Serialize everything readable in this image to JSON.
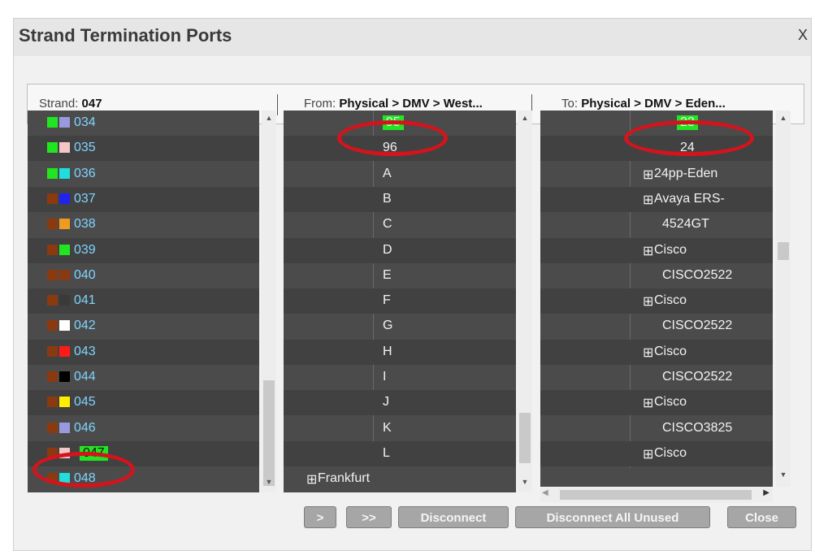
{
  "dialog": {
    "title": "Strand Termination Ports",
    "close_label": "X"
  },
  "header": {
    "strand_label": "Strand:",
    "strand_value": "047",
    "from_label": "From:",
    "from_value": "Physical > DMV > West...",
    "to_label": "To:",
    "to_value": "Physical > DMV > Eden..."
  },
  "strands": [
    {
      "id": "034",
      "c1": "#22e522",
      "c2": "#9999dd"
    },
    {
      "id": "035",
      "c1": "#22e522",
      "c2": "#f4c6c6"
    },
    {
      "id": "036",
      "c1": "#22e522",
      "c2": "#22dddd"
    },
    {
      "id": "037",
      "c1": "#8b3a10",
      "c2": "#2222ee"
    },
    {
      "id": "038",
      "c1": "#8b3a10",
      "c2": "#f09a20"
    },
    {
      "id": "039",
      "c1": "#8b3a10",
      "c2": "#22e522"
    },
    {
      "id": "040",
      "c1": "#8b3a10",
      "c2": "#8b3a10"
    },
    {
      "id": "041",
      "c1": "#8b3a10",
      "c2": "#3a3a3a"
    },
    {
      "id": "042",
      "c1": "#8b3a10",
      "c2": "#ffffff"
    },
    {
      "id": "043",
      "c1": "#8b3a10",
      "c2": "#ff1a1a"
    },
    {
      "id": "044",
      "c1": "#8b3a10",
      "c2": "#000000"
    },
    {
      "id": "045",
      "c1": "#8b3a10",
      "c2": "#ffee00"
    },
    {
      "id": "046",
      "c1": "#8b3a10",
      "c2": "#9999dd"
    },
    {
      "id": "047",
      "c1": "#8b3a10",
      "c2": "#f4c6c6",
      "selected": true
    },
    {
      "id": "048",
      "c1": "#8b3a10",
      "c2": "#22dddd"
    }
  ],
  "from_ports": [
    "95",
    "96",
    "A",
    "B",
    "C",
    "D",
    "E",
    "F",
    "G",
    "H",
    "I",
    "J",
    "K",
    "L"
  ],
  "from_selected": "95",
  "from_folder": "Frankfurt",
  "to_ports": [
    {
      "text": "23",
      "selected": true
    },
    {
      "text": "24"
    },
    {
      "text": "24pp-Eden",
      "expand": true
    },
    {
      "text": "Avaya ERS-",
      "expand": true
    },
    {
      "text": "4524GT"
    },
    {
      "text": "Cisco",
      "expand": true
    },
    {
      "text": "CISCO2522"
    },
    {
      "text": "Cisco",
      "expand": true
    },
    {
      "text": "CISCO2522"
    },
    {
      "text": "Cisco",
      "expand": true
    },
    {
      "text": "CISCO2522"
    },
    {
      "text": "Cisco",
      "expand": true
    },
    {
      "text": "CISCO3825"
    },
    {
      "text": "Cisco",
      "expand": true
    }
  ],
  "buttons": {
    "connect": ">",
    "connect_all": ">>",
    "disconnect": "Disconnect",
    "disconnect_all_unused": "Disconnect All Unused",
    "close": "Close"
  },
  "colors": {
    "highlight": "#22e522",
    "annotation": "#d4141c",
    "panel_bg": "#4b4b4b"
  }
}
